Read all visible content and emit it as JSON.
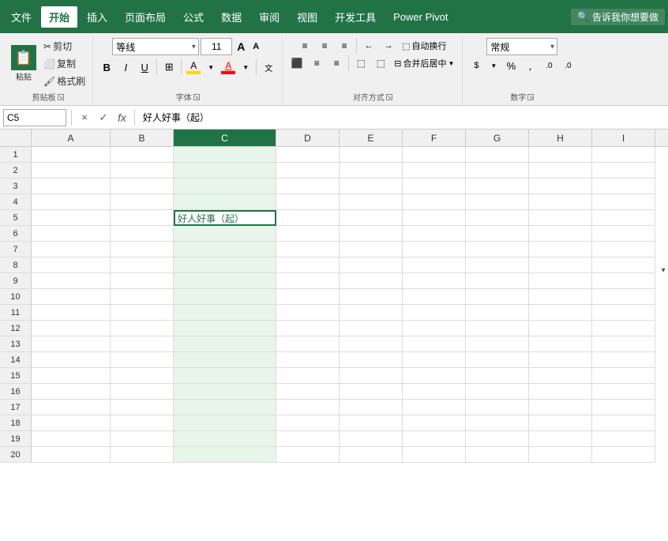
{
  "menu": {
    "items": [
      "文件",
      "开始",
      "插入",
      "页面布局",
      "公式",
      "数据",
      "审阅",
      "视图",
      "开发工具",
      "Power Pivot"
    ],
    "active": "开始",
    "search_placeholder": "告诉我你想要做"
  },
  "ribbon": {
    "clipboard": {
      "label": "剪贴板",
      "paste": "粘贴",
      "cut": "✂ 剪切",
      "copy": "⬜ 复制",
      "format_painter": "🖌 格式刷"
    },
    "font": {
      "label": "字体",
      "name": "等线",
      "size": "11",
      "grow": "A",
      "shrink": "A",
      "bold": "B",
      "italic": "I",
      "underline": "U",
      "border": "⊞",
      "fill_color": "A",
      "font_color": "A"
    },
    "alignment": {
      "label": "对齐方式",
      "wrap": "自动换行",
      "merge": "合并后居中"
    },
    "number": {
      "label": "数字",
      "format": "常规"
    }
  },
  "formula_bar": {
    "cell_ref": "C5",
    "cancel_icon": "×",
    "confirm_icon": "✓",
    "fx": "fx",
    "formula": "好人好事（起）"
  },
  "columns": [
    "A",
    "B",
    "C",
    "D",
    "E",
    "F",
    "G",
    "H",
    "I"
  ],
  "rows": [
    1,
    2,
    3,
    4,
    5,
    6,
    7,
    8,
    9,
    10,
    11,
    12,
    13,
    14,
    15,
    16,
    17,
    18,
    19,
    20
  ],
  "active_cell": {
    "row": 5,
    "col": "C"
  },
  "cell_content": {
    "row": 5,
    "col": "C",
    "value": "好人好事（起）"
  }
}
